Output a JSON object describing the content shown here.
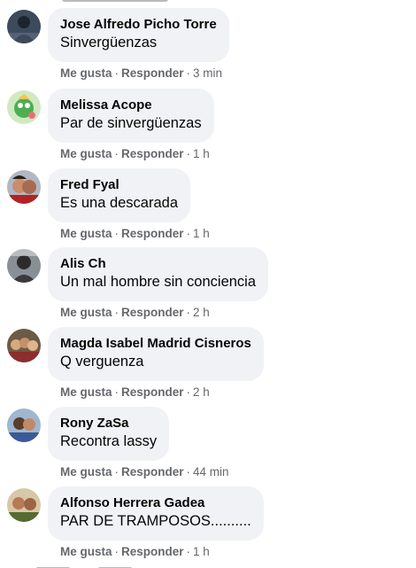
{
  "actions": {
    "like_label": "Me gusta",
    "reply_label": "Responder"
  },
  "comments": [
    {
      "author": "Jose Alfredo Picho Torre",
      "text": "Sinvergüenzas",
      "time": "3 min",
      "avatar": "avatar-dark-figure"
    },
    {
      "author": "Melissa Acope",
      "text": "Par de sinvergüenzas",
      "time": "1 h",
      "avatar": "avatar-green-toy"
    },
    {
      "author": "Fred Fyal",
      "text": "Es una descarada",
      "time": "1 h",
      "avatar": "avatar-photo-person"
    },
    {
      "author": "Alis Ch",
      "text": "Un mal hombre sin conciencia",
      "time": "2 h",
      "avatar": "avatar-photo-person"
    },
    {
      "author": "Magda Isabel Madrid Cisneros",
      "text": "Q verguenza",
      "time": "2 h",
      "avatar": "avatar-photo-group"
    },
    {
      "author": "Rony ZaSa",
      "text": "Recontra lassy",
      "time": "44 min",
      "avatar": "avatar-photo-person"
    },
    {
      "author": "Alfonso Herrera Gadea",
      "text": "PAR DE TRAMPOSOS..........",
      "time": "1 h",
      "avatar": "avatar-photo-group"
    }
  ]
}
